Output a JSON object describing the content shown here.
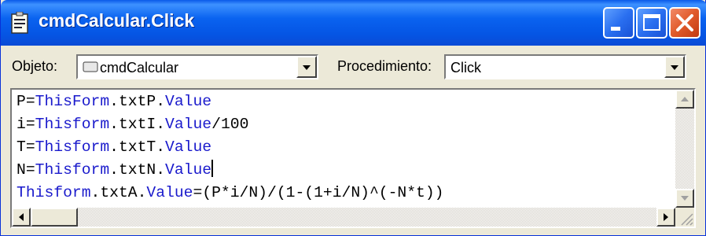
{
  "window": {
    "title": "cmdCalcular.Click",
    "title_icon": "code-window-icon",
    "buttons": [
      "minimize-icon",
      "maximize-icon",
      "close-icon"
    ]
  },
  "toolbar": {
    "objeto_label": "Objeto:",
    "objeto_value": "cmdCalcular",
    "procedimiento_label": "Procedimiento:",
    "procedimiento_value": "Click"
  },
  "code": {
    "lines": [
      [
        {
          "t": "P="
        },
        {
          "t": "ThisForm",
          "kw": true
        },
        {
          "t": ".txtP."
        },
        {
          "t": "Value",
          "kw": true
        }
      ],
      [
        {
          "t": "i="
        },
        {
          "t": "Thisform",
          "kw": true
        },
        {
          "t": ".txtI."
        },
        {
          "t": "Value",
          "kw": true
        },
        {
          "t": "/100"
        }
      ],
      [
        {
          "t": "T="
        },
        {
          "t": "Thisform",
          "kw": true
        },
        {
          "t": ".txtT."
        },
        {
          "t": "Value",
          "kw": true
        }
      ],
      [
        {
          "t": "N="
        },
        {
          "t": "Thisform",
          "kw": true
        },
        {
          "t": ".txtN."
        },
        {
          "t": "Value",
          "kw": true
        },
        {
          "caret": true
        }
      ],
      [
        {
          "t": "Thisform",
          "kw": true
        },
        {
          "t": ".txtA."
        },
        {
          "t": "Value",
          "kw": true
        },
        {
          "t": "=(P*i/N)/(1-(1+i/N)^(-N*t))"
        }
      ]
    ]
  },
  "colors": {
    "keyword": "#1a1acc",
    "titlebar": "#0a63f0",
    "close_button": "#e05a2a"
  }
}
